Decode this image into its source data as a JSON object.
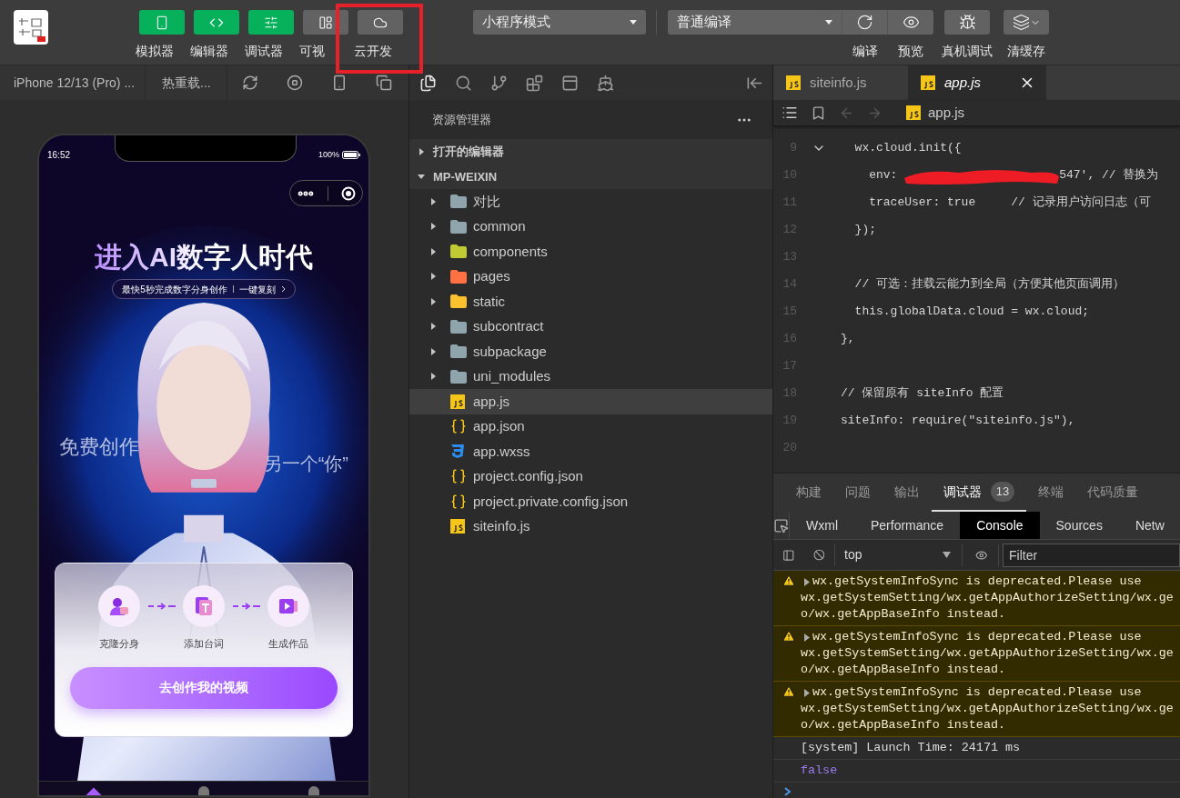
{
  "toolbar": {
    "view_buttons": [
      {
        "label": "模拟器",
        "on": true
      },
      {
        "label": "编辑器",
        "on": true
      },
      {
        "label": "调试器",
        "on": true
      },
      {
        "label": "可视",
        "on": false
      },
      {
        "label": "云开发",
        "on": false
      }
    ],
    "mode_select": "小程序模式",
    "compile_select": "普通编译",
    "actions": [
      {
        "label": "编译"
      },
      {
        "label": "预览"
      },
      {
        "label": "真机调试"
      },
      {
        "label": "清缓存"
      }
    ]
  },
  "simulator": {
    "device": "iPhone 12/13 (Pro) ...",
    "hot_reload": "热重载...",
    "phone": {
      "time": "16:52",
      "battery": "100%",
      "title": "进入AI数字人时代",
      "subtitle": "最快5秒完成数字分身创作",
      "subtitle_link": "一键复刻",
      "left_caption": "免费创作",
      "right_caption": "另一个“你”",
      "steps": [
        {
          "label": "克隆分身"
        },
        {
          "label": "添加台词"
        },
        {
          "label": "生成作品"
        }
      ],
      "cta": "去创作我的视频",
      "tab_bar": [
        {
          "selected": true
        },
        {
          "selected": false
        },
        {
          "selected": false
        }
      ]
    }
  },
  "explorer": {
    "title": "资源管理器",
    "sections": [
      {
        "label": "打开的编辑器",
        "expanded": false
      },
      {
        "label": "MP-WEIXIN",
        "expanded": true
      }
    ],
    "items": [
      {
        "name": "对比",
        "kind": "folder",
        "color": "#90a4ae",
        "expanded": false,
        "selected": false
      },
      {
        "name": "common",
        "kind": "folder",
        "color": "#90a4ae",
        "expanded": false,
        "selected": false
      },
      {
        "name": "components",
        "kind": "folder",
        "color": "#c0ca33",
        "expanded": false,
        "selected": false
      },
      {
        "name": "pages",
        "kind": "folder",
        "color": "#ff7043",
        "expanded": false,
        "selected": false
      },
      {
        "name": "static",
        "kind": "folder",
        "color": "#fbc02d",
        "expanded": false,
        "selected": false
      },
      {
        "name": "subcontract",
        "kind": "folder",
        "color": "#90a4ae",
        "expanded": false,
        "selected": false
      },
      {
        "name": "subpackage",
        "kind": "folder",
        "color": "#90a4ae",
        "expanded": false,
        "selected": false
      },
      {
        "name": "uni_modules",
        "kind": "folder",
        "color": "#90a4ae",
        "expanded": false,
        "selected": false
      },
      {
        "name": "app.js",
        "kind": "js",
        "selected": true
      },
      {
        "name": "app.json",
        "kind": "json",
        "selected": false
      },
      {
        "name": "app.wxss",
        "kind": "css",
        "selected": false
      },
      {
        "name": "project.config.json",
        "kind": "json",
        "selected": false
      },
      {
        "name": "project.private.config.json",
        "kind": "json",
        "selected": false
      },
      {
        "name": "siteinfo.js",
        "kind": "js",
        "selected": false
      }
    ]
  },
  "editor": {
    "tabs": [
      {
        "label": "siteinfo.js",
        "selected": false,
        "preview": false
      },
      {
        "label": "app.js",
        "selected": true,
        "preview": true
      }
    ],
    "breadcrumb": "app.js",
    "lines": [
      {
        "number": "9",
        "kind": "code",
        "code": "  wx.cloud.init({",
        "fold": true
      },
      {
        "number": "10",
        "kind": "redacted",
        "code": "    env: ",
        "code_after": "547', // 替换为",
        "fold": false
      },
      {
        "number": "11",
        "kind": "code",
        "code": "    traceUser: true     // 记录用户访问日志（可",
        "fold": false
      },
      {
        "number": "12",
        "kind": "code",
        "code": "  });",
        "fold": false
      },
      {
        "number": "13",
        "kind": "code",
        "fold": false
      },
      {
        "number": "14",
        "kind": "code",
        "code": "  // 可选：挂载云能力到全局（方便其他页面调用）",
        "fold": false
      },
      {
        "number": "15",
        "kind": "code",
        "code": "  this.globalData.cloud = wx.cloud;",
        "fold": false
      },
      {
        "number": "16",
        "kind": "code",
        "code": "},",
        "fold": false
      },
      {
        "number": "17",
        "kind": "code",
        "fold": false
      },
      {
        "number": "18",
        "kind": "code",
        "code": "// 保留原有 siteInfo 配置",
        "fold": false
      },
      {
        "number": "19",
        "kind": "code",
        "code": "siteInfo: require(\"siteinfo.js\"),",
        "fold": false
      },
      {
        "number": "20",
        "kind": "code",
        "fold": false
      }
    ]
  },
  "panel": {
    "tabs": [
      {
        "label": "构建",
        "selected": false
      },
      {
        "label": "问题",
        "selected": false
      },
      {
        "label": "输出",
        "selected": false
      },
      {
        "label": "调试器",
        "selected": true,
        "badge": "13"
      },
      {
        "label": "终端",
        "selected": false
      },
      {
        "label": "代码质量",
        "selected": false
      }
    ],
    "devtools_tabs": [
      {
        "label": "Wxml",
        "selected": false
      },
      {
        "label": "Performance",
        "selected": false
      },
      {
        "label": "Console",
        "selected": true
      },
      {
        "label": "Sources",
        "selected": false
      },
      {
        "label": "Netw",
        "selected": false
      }
    ],
    "context": "top",
    "filter_placeholder": "Filter",
    "messages": [
      {
        "kind": "warning",
        "lines": [
          "wx.getSystemInfoSync is deprecated.Please use",
          "wx.getSystemSetting/wx.getAppAuthorizeSetting/wx.ge",
          "o/wx.getAppBaseInfo instead."
        ]
      },
      {
        "kind": "warning",
        "lines": [
          "wx.getSystemInfoSync is deprecated.Please use",
          "wx.getSystemSetting/wx.getAppAuthorizeSetting/wx.ge",
          "o/wx.getAppBaseInfo instead."
        ]
      },
      {
        "kind": "warning",
        "lines": [
          "wx.getSystemInfoSync is deprecated.Please use",
          "wx.getSystemSetting/wx.getAppAuthorizeSetting/wx.ge",
          "o/wx.getAppBaseInfo instead."
        ]
      },
      {
        "kind": "log",
        "lines": [
          "[system] Launch Time: 24171 ms"
        ]
      },
      {
        "kind": "value",
        "lines": [
          "false"
        ]
      }
    ]
  }
}
